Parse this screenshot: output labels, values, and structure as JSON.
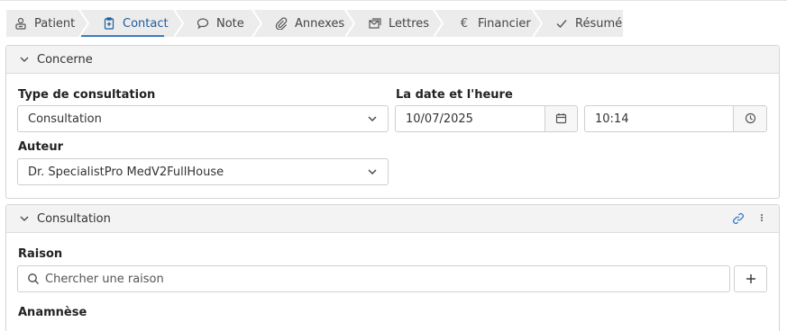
{
  "tabs": [
    {
      "label": "Patient",
      "icon": "patient-icon"
    },
    {
      "label": "Contact",
      "icon": "clipboard-plus-icon",
      "active": true
    },
    {
      "label": "Note",
      "icon": "speech-bubble-icon"
    },
    {
      "label": "Annexes",
      "icon": "paperclip-icon"
    },
    {
      "label": "Lettres",
      "icon": "letters-icon"
    },
    {
      "label": "Financier",
      "icon": "euro-icon"
    },
    {
      "label": "Résumé",
      "icon": "check-icon"
    }
  ],
  "concerne": {
    "title": "Concerne",
    "type_label": "Type de consultation",
    "type_value": "Consultation",
    "date_label": "La date et l'heure",
    "date_value": "10/07/2025",
    "time_value": "10:14",
    "author_label": "Auteur",
    "author_value": "Dr. SpecialistPro MedV2FullHouse"
  },
  "consultation": {
    "title": "Consultation",
    "reason_label": "Raison",
    "reason_placeholder": "Chercher une raison",
    "anamnesis_label": "Anamnèse"
  },
  "colors": {
    "accent": "#1c5d9c",
    "tab_bg": "#ececec",
    "panel_head_bg": "#f3f3f3",
    "border": "#d4d4d4"
  }
}
